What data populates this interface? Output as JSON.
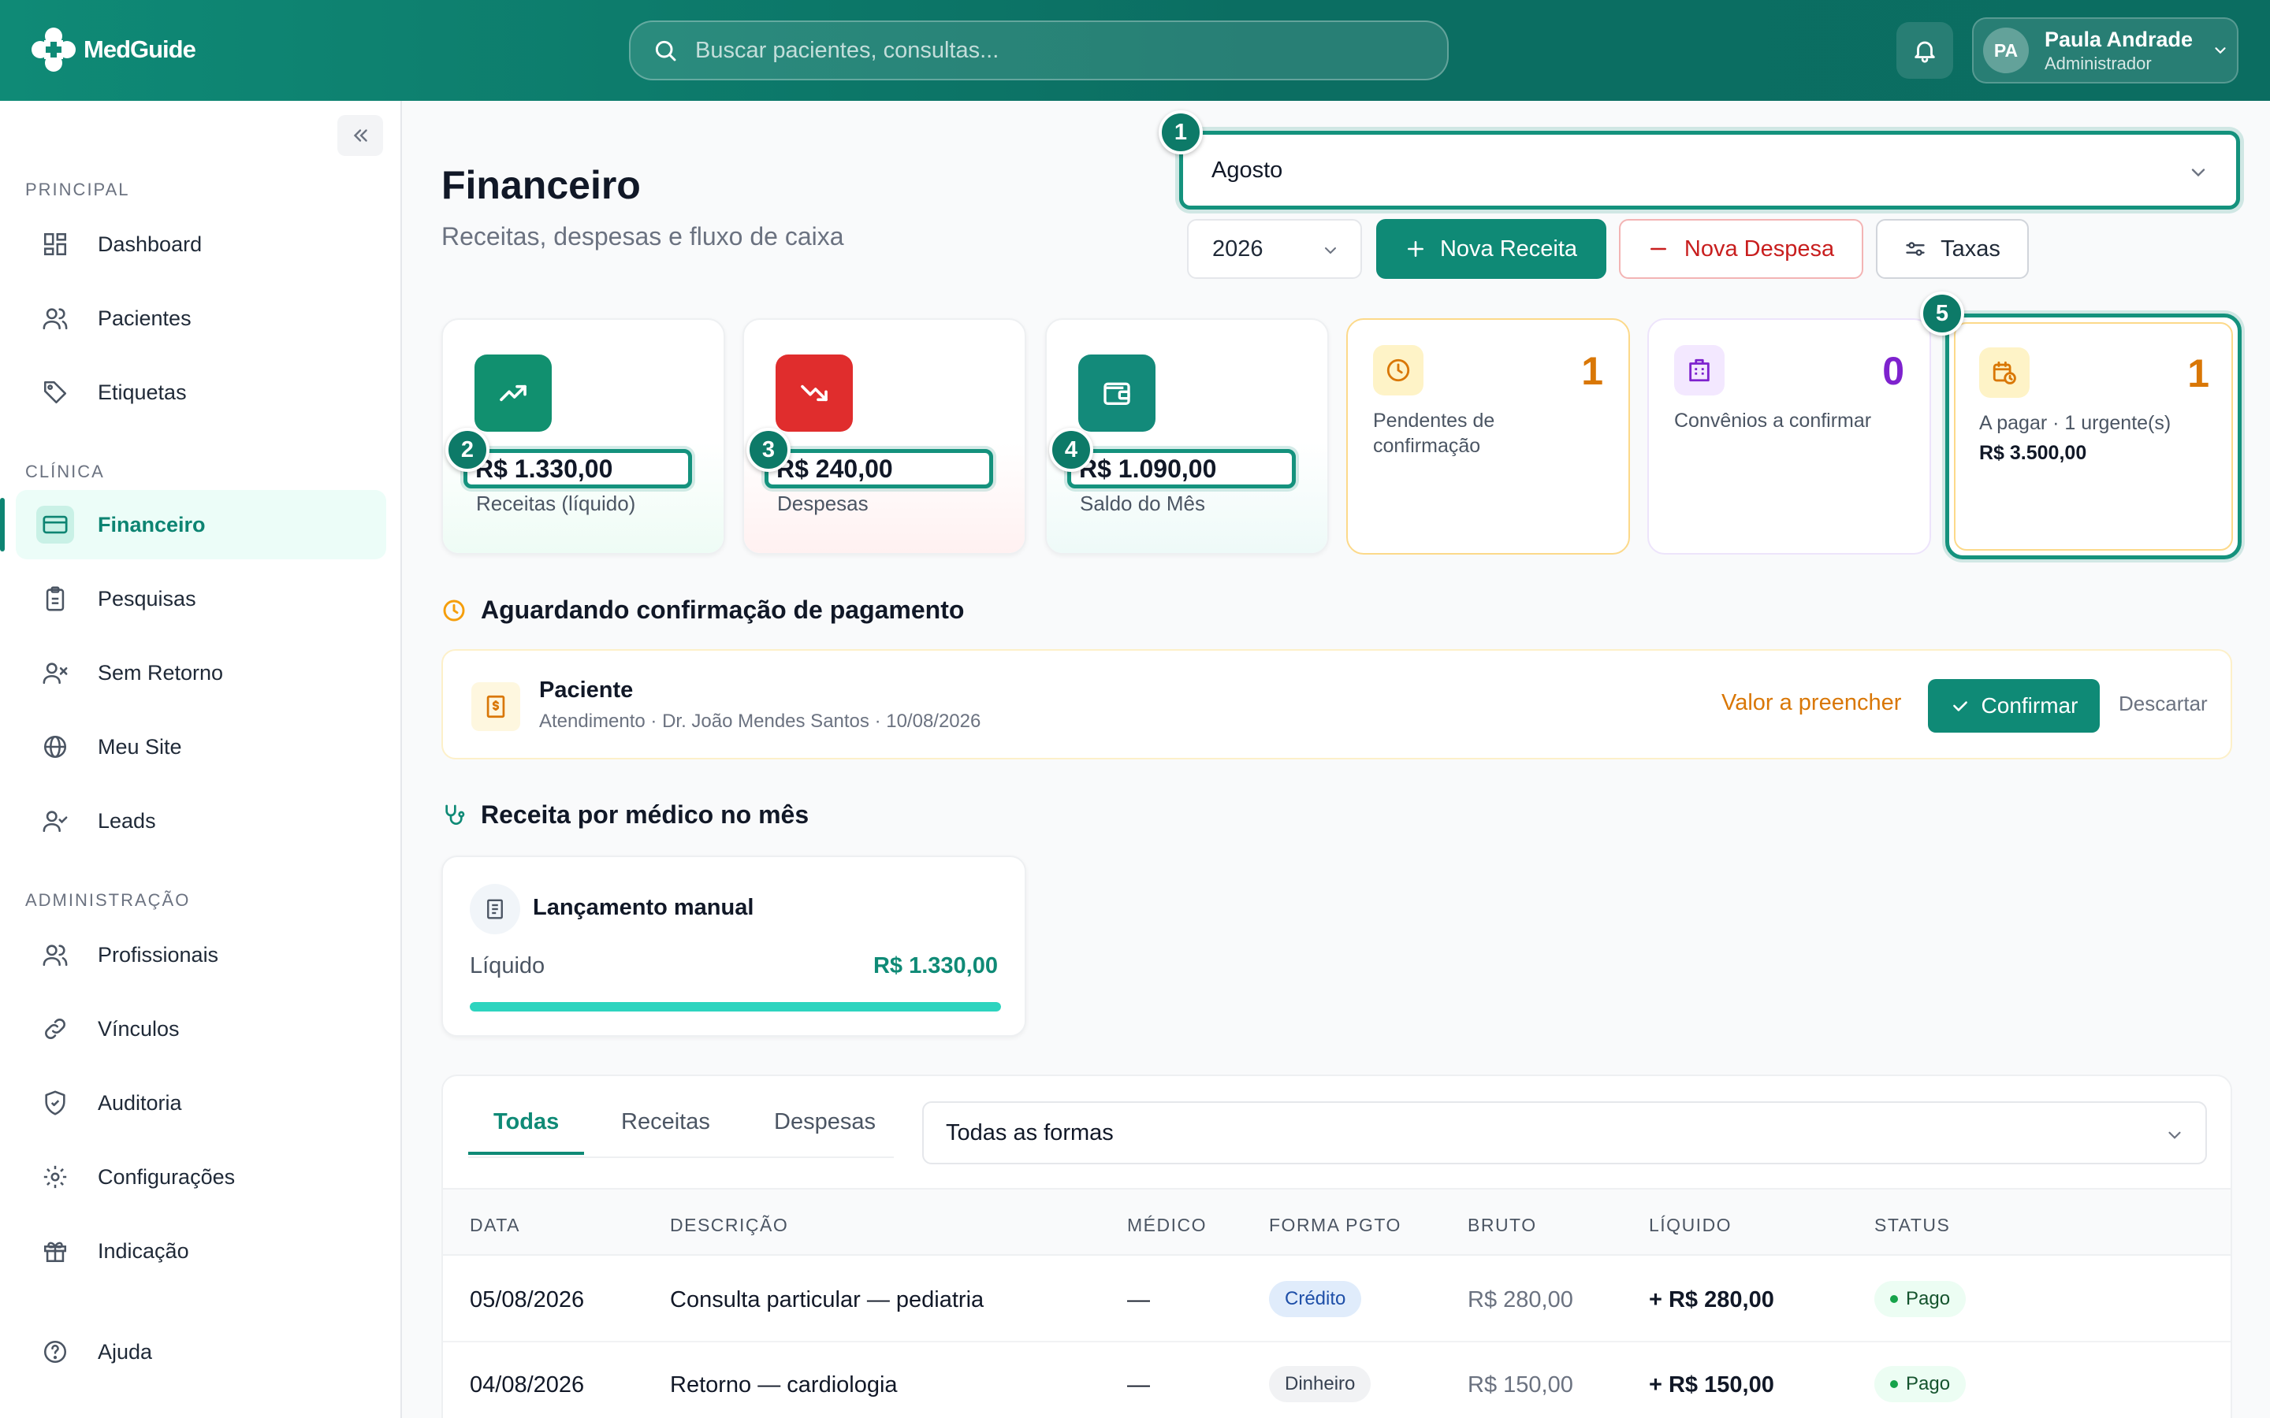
{
  "header": {
    "logo_text": "MedGuide",
    "search_placeholder": "Buscar pacientes, consultas...",
    "user": {
      "initials": "PA",
      "name": "Paula Andrade",
      "role": "Administrador"
    }
  },
  "sidebar": {
    "sections": [
      {
        "label": "PRINCIPAL",
        "items": [
          "Dashboard",
          "Pacientes",
          "Etiquetas"
        ]
      },
      {
        "label": "CLÍNICA",
        "items": [
          "Financeiro",
          "Pesquisas",
          "Sem Retorno",
          "Meu Site",
          "Leads"
        ]
      },
      {
        "label": "ADMINISTRAÇÃO",
        "items": [
          "Profissionais",
          "Vínculos",
          "Auditoria",
          "Configurações",
          "Indicação"
        ]
      }
    ],
    "help": "Ajuda"
  },
  "page": {
    "title": "Financeiro",
    "subtitle": "Receitas, despesas e fluxo de caixa",
    "month": "Agosto",
    "year": "2026",
    "btn_new_income": "Nova Receita",
    "btn_new_expense": "Nova Despesa",
    "btn_fees": "Taxas"
  },
  "badges": [
    "1",
    "2",
    "3",
    "4",
    "5"
  ],
  "stats": [
    {
      "value": "R$ 1.330,00",
      "label": "Receitas (líquido)"
    },
    {
      "value": "R$ 240,00",
      "label": "Despesas"
    },
    {
      "value": "R$ 1.090,00",
      "label": "Saldo do Mês"
    }
  ],
  "mini_cards": [
    {
      "count": "1",
      "label": "Pendentes de confirmação"
    },
    {
      "count": "0",
      "label": "Convênios a confirmar"
    },
    {
      "count": "1",
      "label": "A pagar · 1 urgente(s)",
      "amount": "R$ 3.500,00"
    }
  ],
  "pending": {
    "title": "Aguardando confirmação de pagamento",
    "name": "Paciente",
    "desc": "Atendimento · Dr. João Mendes Santos · 10/08/2026",
    "value_label": "Valor a preencher",
    "confirm": "Confirmar",
    "discard": "Descartar"
  },
  "by_doctor": {
    "title": "Receita por médico no mês",
    "name": "Lançamento manual",
    "liq_label": "Líquido",
    "liq_value": "R$ 1.330,00",
    "share": 1.0
  },
  "transactions": {
    "tabs": [
      "Todas",
      "Receitas",
      "Despesas"
    ],
    "payment_filter": "Todas as formas",
    "columns": [
      "DATA",
      "DESCRIÇÃO",
      "MÉDICO",
      "FORMA PGTO",
      "BRUTO",
      "LÍQUIDO",
      "STATUS"
    ],
    "rows": [
      {
        "date": "05/08/2026",
        "desc": "Consulta particular — pediatria",
        "doctor": "—",
        "method": "Crédito",
        "gross": "R$ 280,00",
        "net": "+ R$ 280,00",
        "status": "Pago"
      },
      {
        "date": "04/08/2026",
        "desc": "Retorno — cardiologia",
        "doctor": "—",
        "method": "Dinheiro",
        "gross": "R$ 150,00",
        "net": "+ R$ 150,00",
        "status": "Pago"
      }
    ]
  },
  "colors": {
    "brand": "#0f8a76",
    "accent": "#2dd4bf",
    "danger": "#c81e1e",
    "warning": "#d97706",
    "purple": "#7e22ce"
  }
}
